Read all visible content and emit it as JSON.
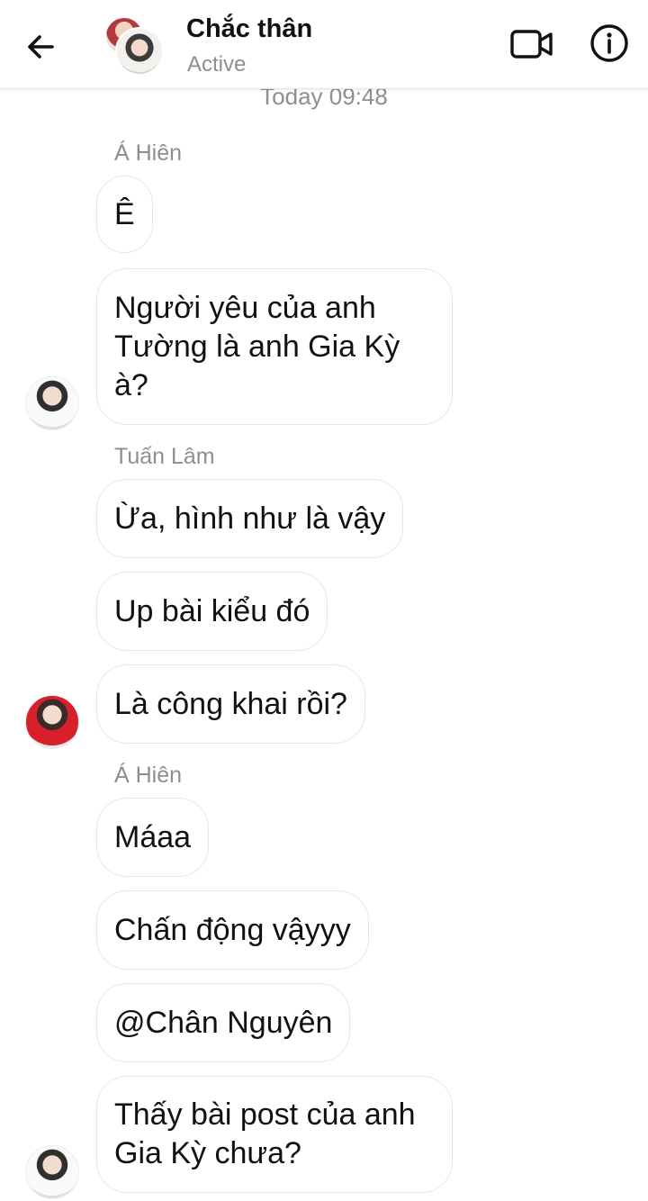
{
  "header": {
    "title": "Chắc thân",
    "status": "Active",
    "icons": {
      "back": "arrow-left-icon",
      "video": "video-camera-icon",
      "info": "info-icon"
    }
  },
  "conversation": {
    "timestamp": "Today 09:48",
    "senders": [
      "Á Hiên",
      "Tuấn Lâm",
      "Á Hiên"
    ],
    "messages": [
      {
        "text": "Ê"
      },
      {
        "text": "Người yêu của anh\nTường là anh Gia Kỳ\nà?"
      },
      {
        "text": "Ừa, hình như là vậy"
      },
      {
        "text": "Up bài kiểu đó"
      },
      {
        "text": "Là công khai rồi?"
      },
      {
        "text": "Máaa"
      },
      {
        "text": "Chấn động vậyyy"
      },
      {
        "text": "@Chân Nguyên"
      },
      {
        "text": "Thấy bài post của anh\nGia Kỳ chưa?"
      }
    ]
  }
}
